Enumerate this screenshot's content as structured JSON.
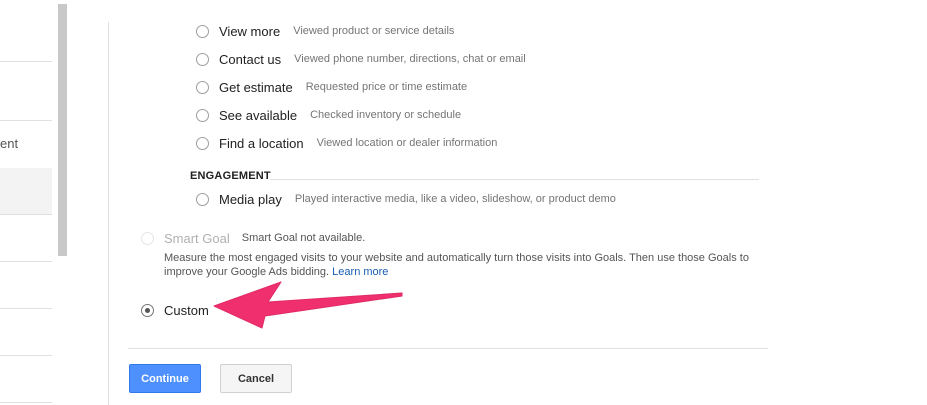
{
  "sidebar": {
    "partial_item": "ent"
  },
  "options": [
    {
      "label": "View more",
      "description": "Viewed product or service details"
    },
    {
      "label": "Contact us",
      "description": "Viewed phone number, directions, chat or email"
    },
    {
      "label": "Get estimate",
      "description": "Requested price or time estimate"
    },
    {
      "label": "See available",
      "description": "Checked inventory or schedule"
    },
    {
      "label": "Find a location",
      "description": "Viewed location or dealer information"
    }
  ],
  "engagement": {
    "heading": "ENGAGEMENT",
    "option": {
      "label": "Media play",
      "description": "Played interactive media, like a video, slideshow, or product demo"
    }
  },
  "smart_goal": {
    "label": "Smart Goal",
    "status": "Smart Goal not available.",
    "description": "Measure the most engaged visits to your website and automatically turn those visits into Goals. Then use those Goals to improve your Google Ads bidding.",
    "link": "Learn more"
  },
  "custom": {
    "label": "Custom",
    "selected": true
  },
  "buttons": {
    "continue": "Continue",
    "cancel": "Cancel"
  },
  "colors": {
    "arrow": "#f0306e",
    "primary_button": "#4d90fe",
    "link": "#1a5fb4"
  }
}
